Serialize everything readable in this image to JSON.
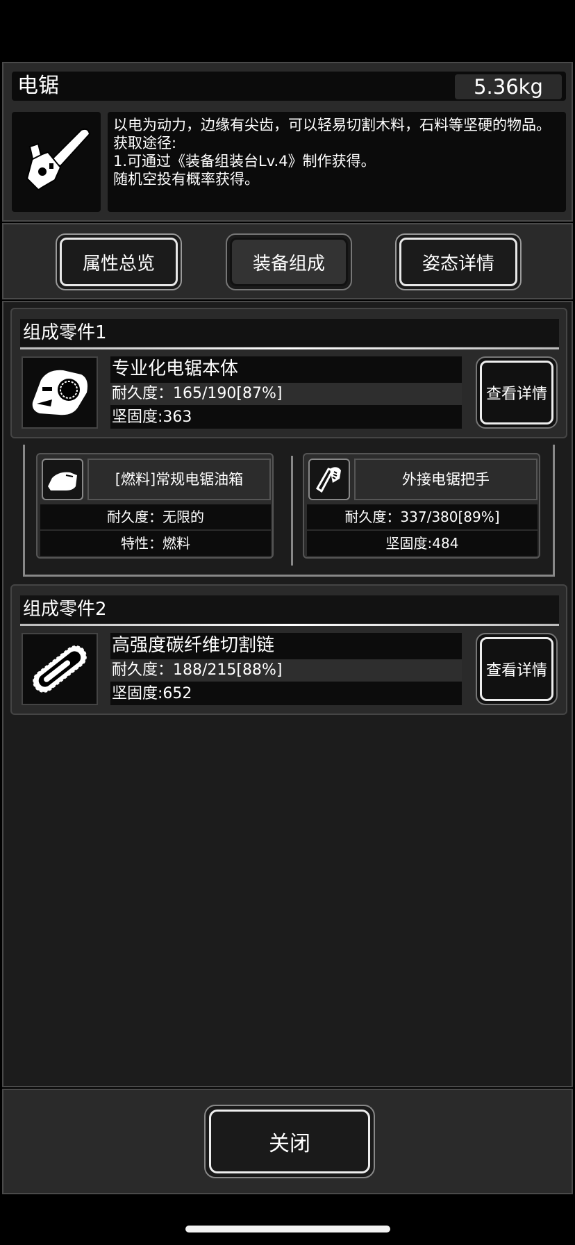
{
  "item": {
    "name": "电锯",
    "weight": "5.36kg",
    "description": [
      "以电为动力，边缘有尖齿，可以轻易切割木料，石料等坚硬的物品。",
      "获取途径:",
      "1.可通过《装备组装台Lv.4》制作获得。",
      "随机空投有概率获得。"
    ],
    "icon": "chainsaw-icon"
  },
  "tabs": [
    {
      "label": "属性总览",
      "active": false
    },
    {
      "label": "装备组成",
      "active": true
    },
    {
      "label": "姿态详情",
      "active": false
    }
  ],
  "parts": [
    {
      "heading": "组成零件1",
      "icon": "chainsaw-body-icon",
      "name": "专业化电锯本体",
      "durability": "耐久度：165/190[87%]",
      "hardness": "坚固度:363",
      "detail_label": "查看详情",
      "subparts": [
        {
          "icon": "fuel-tank-icon",
          "name": "[燃料]常规电锯油箱",
          "row1": "耐久度：无限的",
          "row2": "特性：燃料"
        },
        {
          "icon": "handle-icon",
          "name": "外接电锯把手",
          "row1": "耐久度：337/380[89%]",
          "row2": "坚固度:484"
        }
      ]
    },
    {
      "heading": "组成零件2",
      "icon": "saw-chain-icon",
      "name": "高强度碳纤维切割链",
      "durability": "耐久度：188/215[88%]",
      "hardness": "坚固度:652",
      "detail_label": "查看详情"
    }
  ],
  "close_label": "关闭"
}
